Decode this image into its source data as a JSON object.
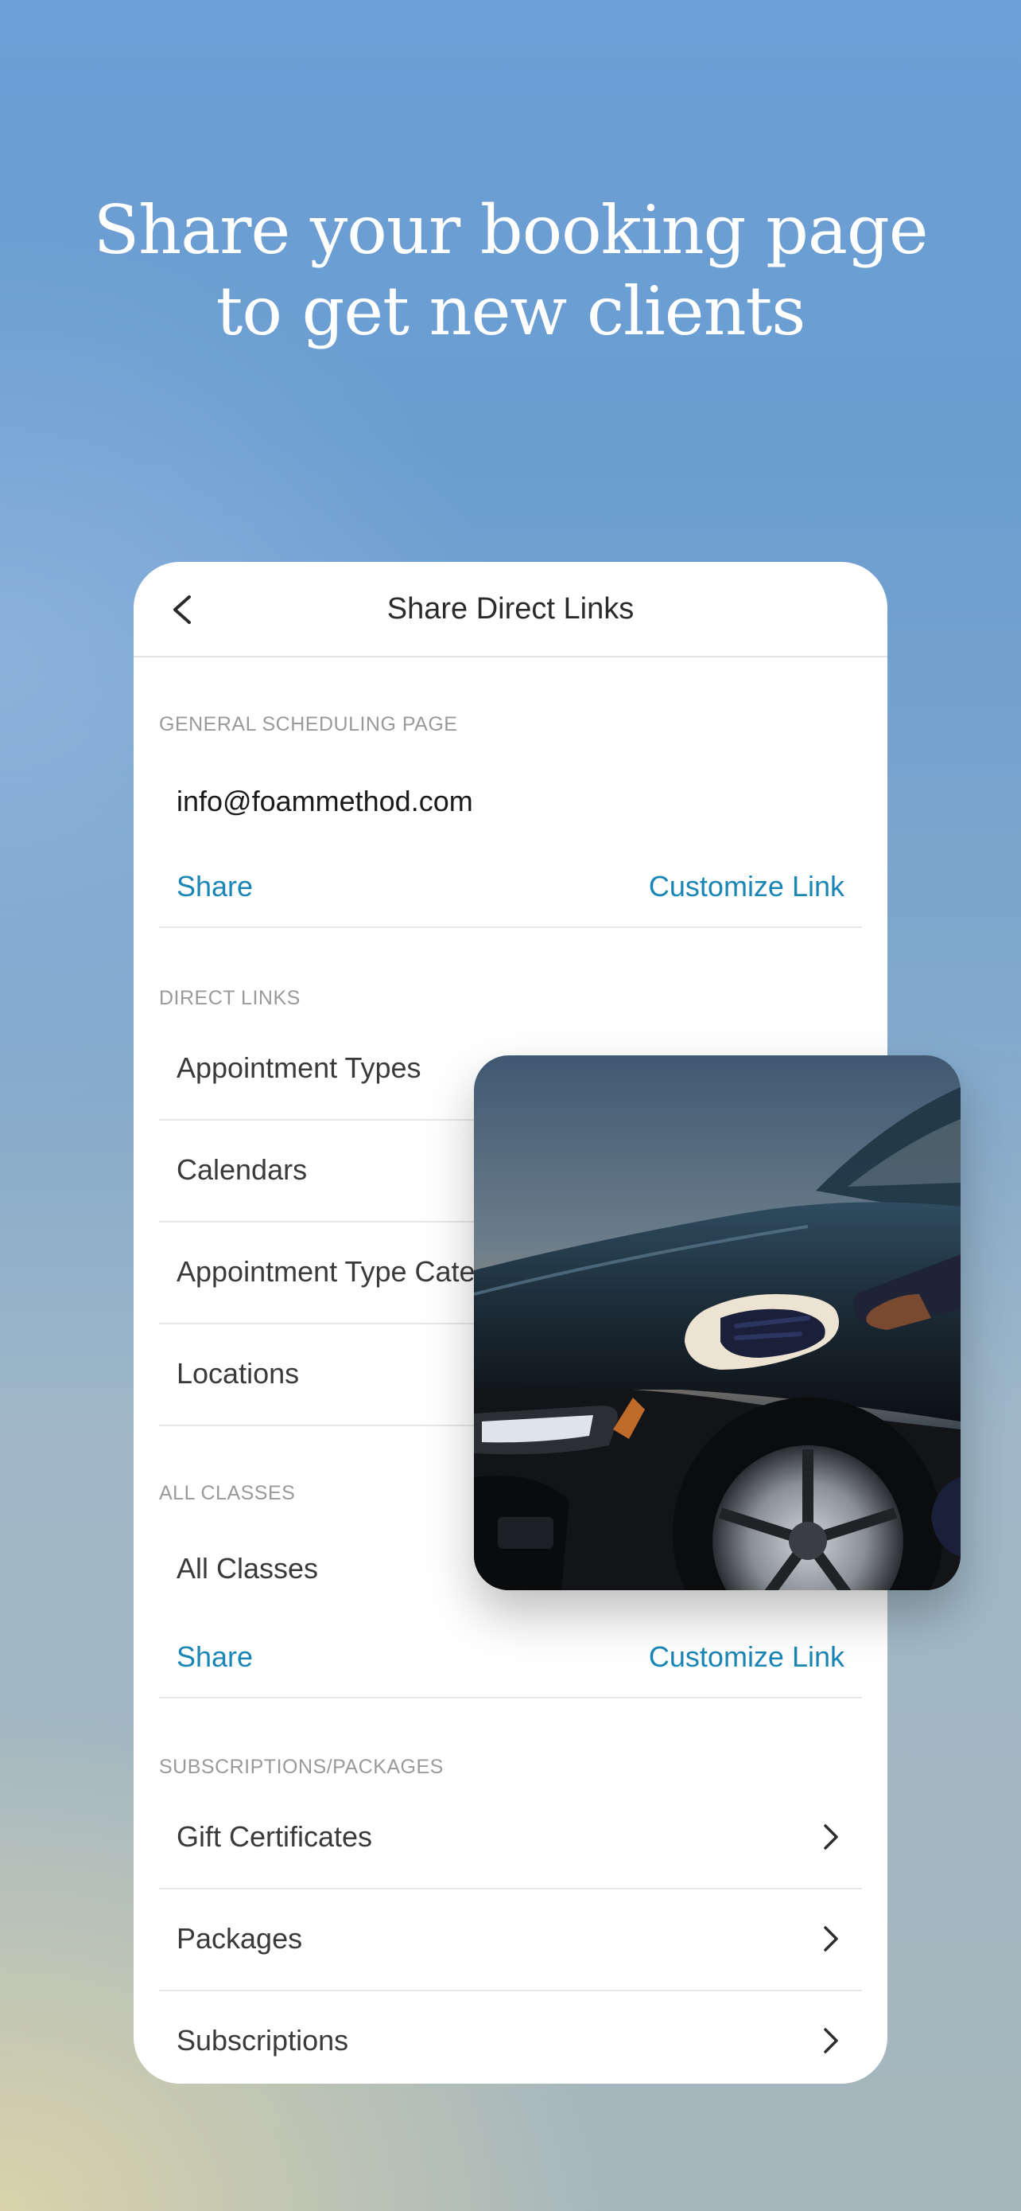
{
  "headline": {
    "line1": "Share your booking page",
    "line2": "to get new clients"
  },
  "screen": {
    "title": "Share Direct Links",
    "back_icon": "chevron-left-icon",
    "general": {
      "header": "GENERAL SCHEDULING PAGE",
      "value": "info@foammethod.com",
      "share_label": "Share",
      "customize_label": "Customize Link"
    },
    "direct_links": {
      "header": "DIRECT LINKS",
      "items": [
        {
          "label": "Appointment Types"
        },
        {
          "label": "Calendars"
        },
        {
          "label": "Appointment Type Categories"
        },
        {
          "label": "Locations"
        }
      ]
    },
    "all_classes": {
      "header": "ALL CLASSES",
      "value": "All Classes",
      "share_label": "Share",
      "customize_label": "Customize Link"
    },
    "subscriptions": {
      "header": "SUBSCRIPTIONS/PACKAGES",
      "items": [
        {
          "label": "Gift Certificates"
        },
        {
          "label": "Packages"
        },
        {
          "label": "Subscriptions"
        }
      ]
    }
  },
  "colors": {
    "link": "#1a86b6",
    "text": "#3a3a3a",
    "header": "#9a9a9a"
  },
  "photo": {
    "subject": "car-detailing-photo"
  }
}
